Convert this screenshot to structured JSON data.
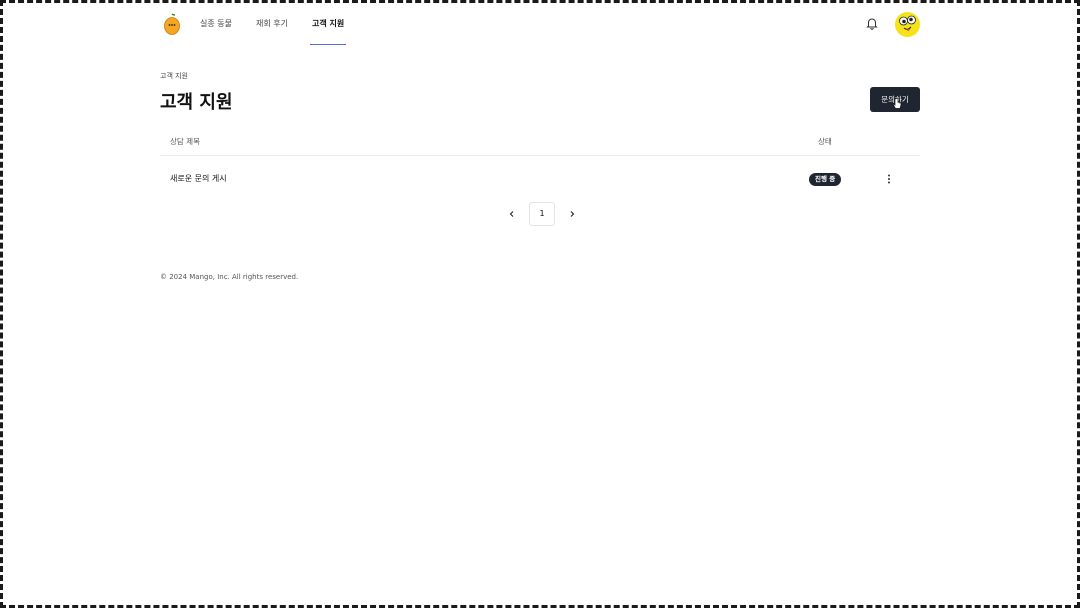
{
  "header": {
    "nav": [
      {
        "label": "실종 동물",
        "active": false
      },
      {
        "label": "재회 후기",
        "active": false
      },
      {
        "label": "고객 지원",
        "active": true
      }
    ]
  },
  "page": {
    "breadcrumb": "고객 지원",
    "title": "고객 지원",
    "inquiry_button": "문의하기"
  },
  "table": {
    "columns": {
      "title": "상담 제목",
      "status": "상태"
    },
    "rows": [
      {
        "title": "새로운 문의 게시",
        "status": "진행 중"
      }
    ]
  },
  "pagination": {
    "current": "1"
  },
  "footer": {
    "copyright": "© 2024 Mango, Inc. All rights reserved."
  },
  "colors": {
    "accent": "#5b6ee1",
    "dark": "#1f2632",
    "logo": "#f5a623",
    "avatar_bg": "#f5e21a"
  },
  "icons": {
    "logo": "mango-logo-icon",
    "bell": "bell-icon",
    "avatar": "avatar-face-icon",
    "more": "more-vertical-icon",
    "prev": "chevron-left-icon",
    "next": "chevron-right-icon",
    "cursor": "hand-pointer-icon"
  }
}
